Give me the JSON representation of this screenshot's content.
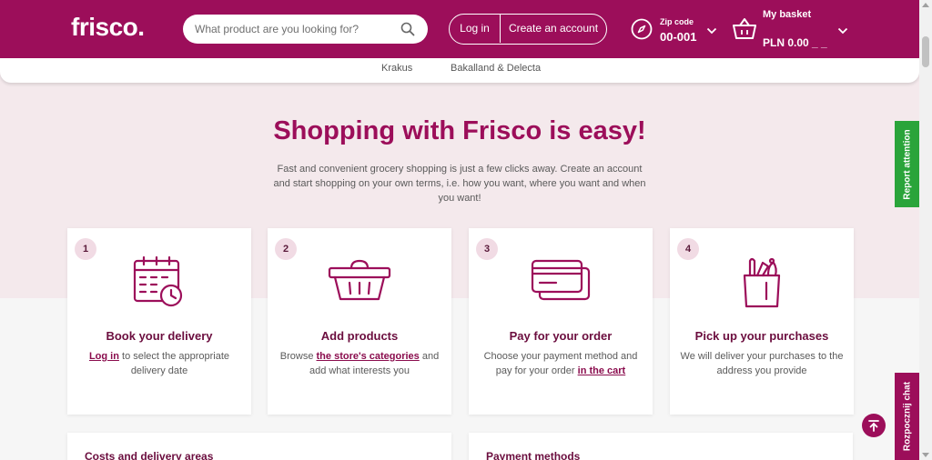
{
  "header": {
    "logo": "frisco.",
    "search_placeholder": "What product are you looking for?",
    "login": "Log in",
    "create_account": "Create an account",
    "zip_label": "Zip code",
    "zip_value": "00-001",
    "basket_label": "My basket",
    "basket_total": "PLN 0.00 _ _"
  },
  "brands": [
    "Krakus",
    "Bakalland & Delecta"
  ],
  "hero": {
    "title": "Shopping with Frisco is easy!",
    "description": "Fast and convenient grocery shopping is just a few clicks away. Create an account and start shopping on your own terms, i.e. how you want, where you want and when you want!"
  },
  "steps": [
    {
      "number": "1",
      "icon": "calendar-clock-icon",
      "title": "Book your delivery",
      "pre": "",
      "link": "Log in",
      "post": " to select the appropriate delivery date"
    },
    {
      "number": "2",
      "icon": "basket-icon",
      "title": "Add products",
      "pre": "Browse ",
      "link": "the store's categories",
      "post": " and add what interests you"
    },
    {
      "number": "3",
      "icon": "credit-cards-icon",
      "title": "Pay for your order",
      "pre": "Choose your payment method and pay for your order ",
      "link": "in the cart",
      "post": ""
    },
    {
      "number": "4",
      "icon": "grocery-bag-icon",
      "title": "Pick up your purchases",
      "pre": "We will deliver your purchases to the address you provide",
      "link": "",
      "post": ""
    }
  ],
  "info_cards": [
    "Costs and delivery areas",
    "Payment methods"
  ],
  "side": {
    "report": "Report attention",
    "chat": "Rozpocznij chat"
  },
  "colors": {
    "brand": "#9c0e5a",
    "report": "#2aa43a",
    "band": "#f4e9ec"
  }
}
